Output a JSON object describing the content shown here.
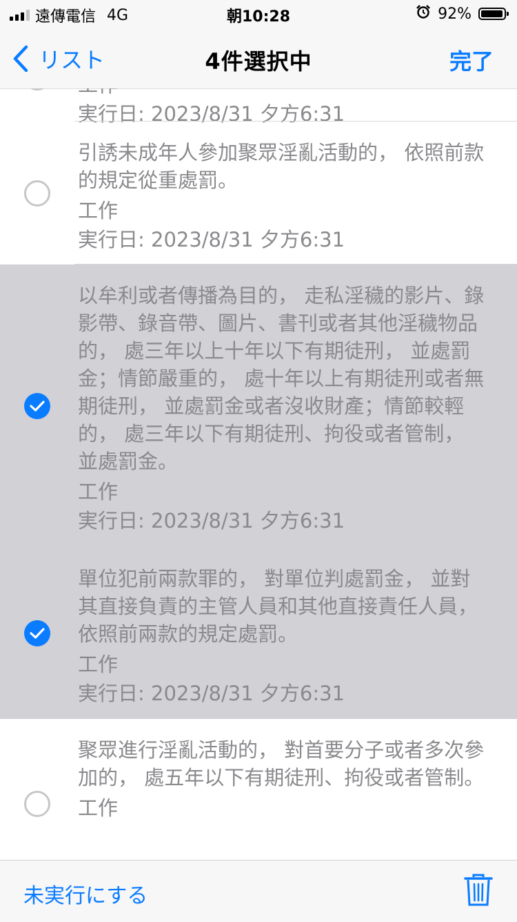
{
  "status_bar": {
    "carrier": "遠傳電信",
    "network": "4G",
    "time": "朝10:28",
    "alarm_icon": "alarm-clock-icon",
    "battery_percent": "92%",
    "battery_level": 0.92
  },
  "nav": {
    "back_label": "リスト",
    "title": "4件選択中",
    "done_label": "完了"
  },
  "list": {
    "partial_top": {
      "category": "工作",
      "date": "実行日: 2023/8/31 夕方6:31"
    },
    "items": [
      {
        "text": "引誘未成年人參加聚眾淫亂活動的， 依照前款的規定從重處罰。",
        "category": "工作",
        "date": "実行日: 2023/8/31 夕方6:31",
        "selected": false
      },
      {
        "text": "以牟利或者傳播為目的， 走私淫穢的影片、錄影帶、錄音帶、圖片、書刊或者其他淫穢物品的， 處三年以上十年以下有期徒刑， 並處罰金；情節嚴重的， 處十年以上有期徒刑或者無期徒刑， 並處罰金或者沒收財產；情節較輕的， 處三年以下有期徒刑、拘役或者管制， 並處罰金。",
        "category": "工作",
        "date": "実行日: 2023/8/31 夕方6:31",
        "selected": true
      },
      {
        "text": "單位犯前兩款罪的， 對單位判處罰金， 並對其直接負責的主管人員和其他直接責任人員， 依照前兩款的規定處罰。",
        "category": "工作",
        "date": "実行日: 2023/8/31 夕方6:31",
        "selected": true
      },
      {
        "text": "聚眾進行淫亂活動的， 對首要分子或者多次參加的， 處五年以下有期徒刑、拘役或者管制。",
        "category": "工作",
        "selected": false
      }
    ]
  },
  "toolbar": {
    "mark_incomplete_label": "未実行にする",
    "trash_icon": "trash-icon"
  },
  "colors": {
    "accent": "#0a7cff",
    "selected_row": "#d1d1d6",
    "secondary_text": "#8a8a8e"
  }
}
